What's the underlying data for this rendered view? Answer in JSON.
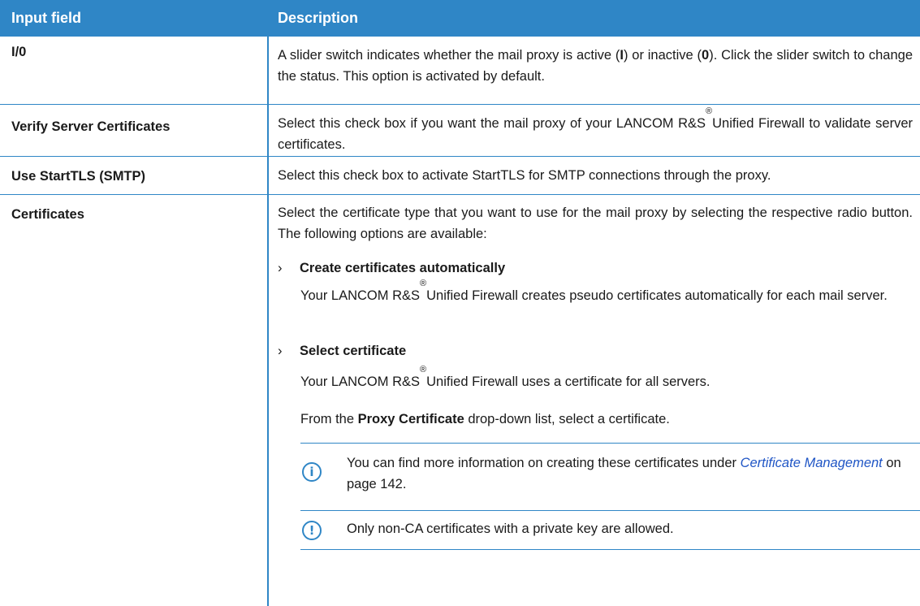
{
  "header": {
    "col1": "Input field",
    "col2": "Description"
  },
  "rows": {
    "io": {
      "label": "I/0",
      "desc_parts": [
        "A slider switch indicates whether the mail proxy is active (",
        "I",
        ") or inactive (",
        "0",
        "). Click the slider switch to change the status. This option is activated by default."
      ]
    },
    "verify": {
      "label": "Verify Server Certificates",
      "desc_a": "Select this check box if you want the mail proxy of your LANCOM R&S",
      "reg": "®",
      "desc_b": "Unified Firewall to validate server certificates."
    },
    "starttls": {
      "label": "Use StartTLS (SMTP)",
      "desc": "Select this check box to activate StartTLS for SMTP connections through the proxy."
    },
    "certs": {
      "label": "Certificates",
      "intro": "Select the certificate type that you want to use for the mail proxy by selecting the respective radio button. The following options are available:",
      "option1_title": "Create certificates automatically",
      "option1_a": "Your LANCOM R&S",
      "option1_reg": "®",
      "option1_b": "Unified Firewall creates pseudo certificates automatically for each mail server.",
      "option2_title": "Select certificate",
      "option2_a": "Your LANCOM R&S",
      "option2_reg": "®",
      "option2_b": "Unified Firewall uses a certificate for all servers.",
      "proxy_a": "From the ",
      "proxy_bold": "Proxy Certificate",
      "proxy_b": " drop-down list, select a certificate.",
      "note_info_a": "You can find more information on creating these certificates under ",
      "note_info_link": "Certificate Management",
      "note_info_b": " on page 142.",
      "note_warn": "Only non-CA certificates with a private key are allowed."
    }
  },
  "icons": {
    "chevron": "›",
    "info": "i",
    "warning": "!"
  },
  "colors": {
    "accent": "#2f86c6",
    "link": "#1f55c5"
  }
}
